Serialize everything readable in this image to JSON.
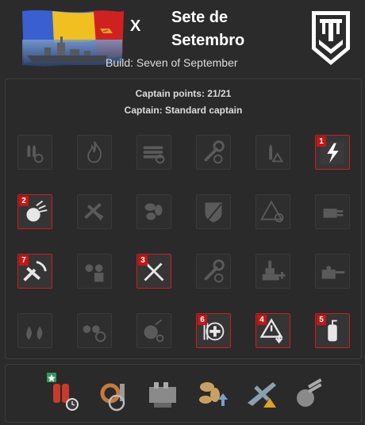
{
  "header": {
    "tier": "X",
    "ship_name_line1": "Sete de",
    "ship_name_line2": "Setembro",
    "build_label": "Build: Seven of September",
    "colors": {
      "flag_blue": "#3a5fd0",
      "flag_yellow": "#f0c020",
      "flag_red": "#d02020"
    }
  },
  "skills_panel": {
    "captain_points": "Captain points: 21/21",
    "captain": "Captain: Standard captain",
    "rows": [
      [
        {
          "icon": "shells-reload-icon",
          "badge": null
        },
        {
          "icon": "fire-icon",
          "badge": null
        },
        {
          "icon": "torpedo-reload-icon",
          "badge": null
        },
        {
          "icon": "wrench-reload-icon",
          "badge": null
        },
        {
          "icon": "shell-warning-icon",
          "badge": null
        },
        {
          "icon": "lightning-icon",
          "badge": "1"
        }
      ],
      [
        {
          "icon": "aa-burst-icon",
          "badge": "2"
        },
        {
          "icon": "broken-plane-icon",
          "badge": null
        },
        {
          "icon": "propeller-icon",
          "badge": null
        },
        {
          "icon": "shield-icon",
          "badge": null
        },
        {
          "icon": "warning-crosshair-icon",
          "badge": null
        },
        {
          "icon": "secondary-turret-icon",
          "badge": null
        }
      ],
      [
        {
          "icon": "aa-sector-icon",
          "badge": "7"
        },
        {
          "icon": "turrets-icon",
          "badge": null
        },
        {
          "icon": "crossed-swords-icon",
          "badge": "3"
        },
        {
          "icon": "wrench-timer-icon",
          "badge": null
        },
        {
          "icon": "ship-repair-icon",
          "badge": null
        },
        {
          "icon": "gun-turret-icon",
          "badge": null
        }
      ],
      [
        {
          "icon": "double-fire-icon",
          "badge": null
        },
        {
          "icon": "turrets-crosshair-icon",
          "badge": null
        },
        {
          "icon": "turret-reload-icon",
          "badge": null
        },
        {
          "icon": "heal-plus-icon",
          "badge": "6"
        },
        {
          "icon": "warning-down-icon",
          "badge": "4"
        },
        {
          "icon": "fire-extinguisher-icon",
          "badge": "5"
        }
      ]
    ]
  },
  "modernizations": [
    {
      "icon": "damage-control-system-icon",
      "starred": true
    },
    {
      "icon": "hose-valve-icon",
      "starred": false
    },
    {
      "icon": "main-battery-icon",
      "starred": false
    },
    {
      "icon": "propulsion-icon",
      "starred": false
    },
    {
      "icon": "aircraft-warning-icon",
      "starred": false
    },
    {
      "icon": "secondary-battery-icon",
      "starred": false
    }
  ]
}
